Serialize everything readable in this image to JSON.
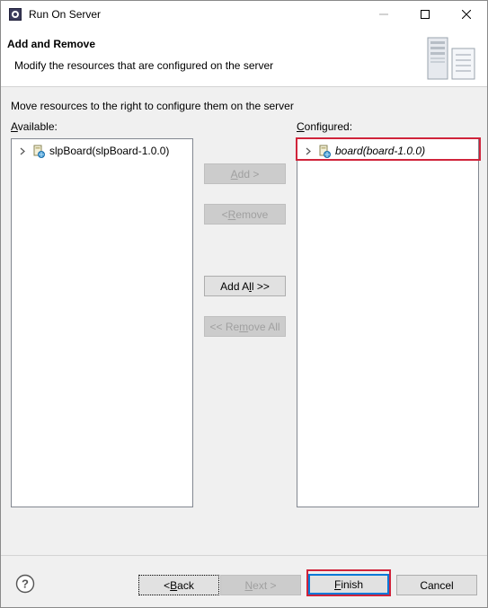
{
  "window": {
    "title": "Run On Server",
    "title_icon": "server-gear-icon",
    "controls": [
      "minimize",
      "maximize",
      "close"
    ]
  },
  "header": {
    "title": "Add and Remove",
    "description": "Modify the resources that are configured on the server",
    "image": "server-wizard-banner-icon"
  },
  "instruction": "Move resources to the right to configure them on the server",
  "available": {
    "label_mnemonic": "A",
    "label_rest": "vailable:",
    "items": [
      {
        "label": "slpBoard(slpBoard-1.0.0)",
        "icon": "web-module-icon",
        "expanded": false
      }
    ]
  },
  "configured": {
    "label_mnemonic": "C",
    "label_rest": "onfigured:",
    "items": [
      {
        "label": "board(board-1.0.0)",
        "icon": "web-module-icon",
        "expanded": false,
        "italic": true
      }
    ]
  },
  "buttons": {
    "add": {
      "pre": "",
      "mnemonic": "A",
      "post": "dd >",
      "enabled": false
    },
    "remove": {
      "pre": "< ",
      "mnemonic": "R",
      "post": "emove",
      "enabled": false
    },
    "add_all": {
      "pre": "Add A",
      "mnemonic": "l",
      "post": "l >>",
      "enabled": true
    },
    "remove_all": {
      "pre": "<< Re",
      "mnemonic": "m",
      "post": "ove All",
      "enabled": false
    }
  },
  "footer": {
    "help_icon": "help-icon",
    "back": {
      "pre": "< ",
      "mnemonic": "B",
      "post": "ack",
      "enabled": true
    },
    "next": {
      "pre": "",
      "mnemonic": "N",
      "post": "ext >",
      "enabled": false
    },
    "finish": {
      "pre": "",
      "mnemonic": "F",
      "post": "inish",
      "enabled": true
    },
    "cancel": {
      "label": "Cancel",
      "enabled": true
    }
  },
  "colors": {
    "highlight": "#d0243b",
    "focus": "#0078d7",
    "dialog_bg": "#f0f0f0"
  }
}
